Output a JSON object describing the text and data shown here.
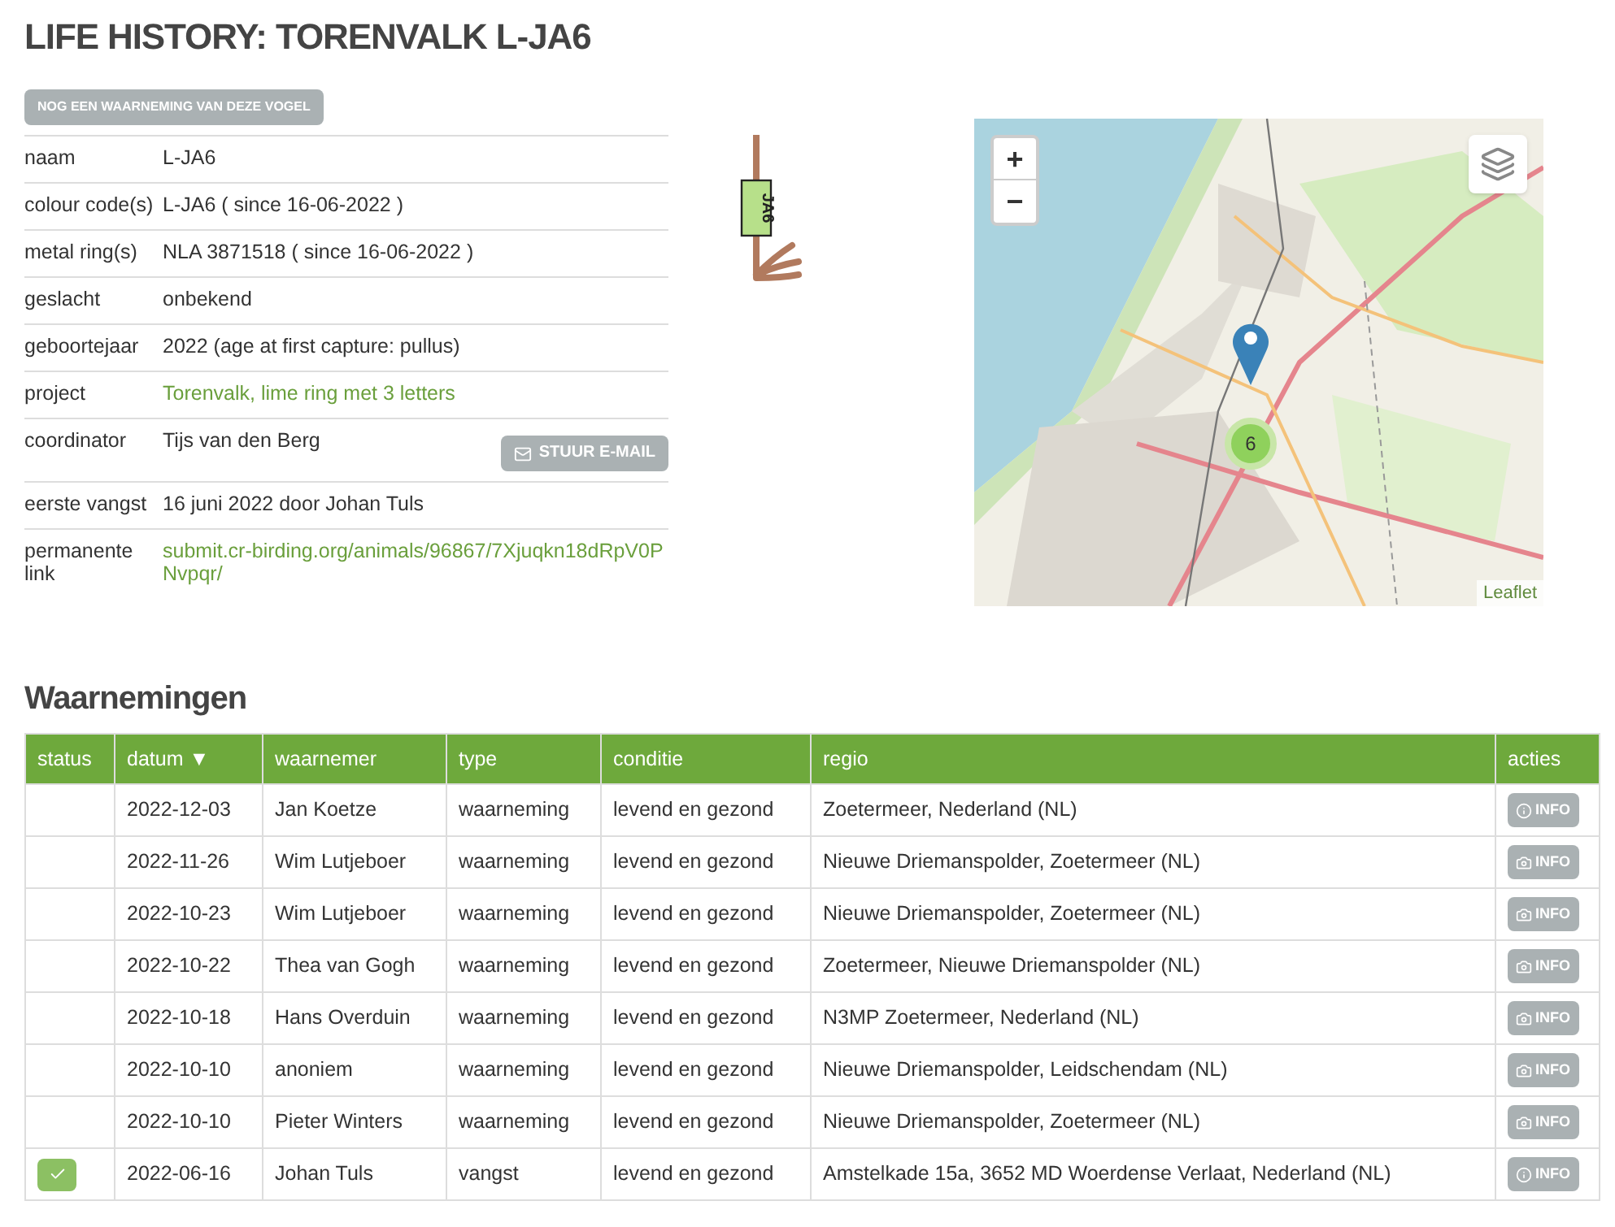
{
  "title": "LIFE HISTORY: TORENVALK L-JA6",
  "another_button": "NOG EEN WAARNEMING VAN DEZE VOGEL",
  "details": [
    {
      "label": "naam",
      "value": "L-JA6",
      "kind": "text"
    },
    {
      "label": "colour code(s)",
      "value": "L-JA6 ( since 16-06-2022 )",
      "kind": "text"
    },
    {
      "label": "metal ring(s)",
      "value": "NLA 3871518 ( since 16-06-2022 )",
      "kind": "text"
    },
    {
      "label": "geslacht",
      "value": "onbekend",
      "kind": "text"
    },
    {
      "label": "geboortejaar",
      "value": "2022 (age at first capture: pullus)",
      "kind": "text"
    },
    {
      "label": "project",
      "value": "Torenvalk, lime ring met 3 letters",
      "kind": "link"
    },
    {
      "label": "coordinator",
      "value": "Tijs van den Berg",
      "kind": "email",
      "button": "STUUR E-MAIL"
    },
    {
      "label": "eerste vangst",
      "value": "16 juni 2022 door Johan Tuls",
      "kind": "text"
    },
    {
      "label": "permanente link",
      "value": "submit.cr-birding.org/animals/96867/7Xjuqkn18dRpV0PNvpqr/",
      "kind": "link"
    }
  ],
  "ring": {
    "code": "JA6"
  },
  "map": {
    "zoom_in": "+",
    "zoom_out": "−",
    "cluster_count": "6",
    "attribution": "Leaflet"
  },
  "section_title": "Waarnemingen",
  "table": {
    "columns": [
      {
        "label": "status"
      },
      {
        "label": "datum ▼"
      },
      {
        "label": "waarnemer"
      },
      {
        "label": "type"
      },
      {
        "label": "conditie"
      },
      {
        "label": "regio"
      },
      {
        "label": "acties"
      }
    ],
    "rows": [
      {
        "verified": false,
        "datum": "2022-12-03",
        "waarnemer": "Jan Koetze",
        "type": "waarneming",
        "conditie": "levend en gezond",
        "regio": "Zoetermeer, Nederland (NL)",
        "action": "INFO",
        "kind": "info"
      },
      {
        "verified": false,
        "datum": "2022-11-26",
        "waarnemer": "Wim Lutjeboer",
        "type": "waarneming",
        "conditie": "levend en gezond",
        "regio": "Nieuwe Driemanspolder, Zoetermeer (NL)",
        "action": "INFO",
        "kind": "camera"
      },
      {
        "verified": false,
        "datum": "2022-10-23",
        "waarnemer": "Wim Lutjeboer",
        "type": "waarneming",
        "conditie": "levend en gezond",
        "regio": "Nieuwe Driemanspolder, Zoetermeer (NL)",
        "action": "INFO",
        "kind": "camera"
      },
      {
        "verified": false,
        "datum": "2022-10-22",
        "waarnemer": "Thea van Gogh",
        "type": "waarneming",
        "conditie": "levend en gezond",
        "regio": "Zoetermeer, Nieuwe Driemanspolder (NL)",
        "action": "INFO",
        "kind": "camera"
      },
      {
        "verified": false,
        "datum": "2022-10-18",
        "waarnemer": "Hans Overduin",
        "type": "waarneming",
        "conditie": "levend en gezond",
        "regio": "N3MP Zoetermeer, Nederland (NL)",
        "action": "INFO",
        "kind": "camera"
      },
      {
        "verified": false,
        "datum": "2022-10-10",
        "waarnemer": "anoniem",
        "type": "waarneming",
        "conditie": "levend en gezond",
        "regio": "Nieuwe Driemanspolder, Leidschendam (NL)",
        "action": "INFO",
        "kind": "camera"
      },
      {
        "verified": false,
        "datum": "2022-10-10",
        "waarnemer": "Pieter Winters",
        "type": "waarneming",
        "conditie": "levend en gezond",
        "regio": "Nieuwe Driemanspolder, Zoetermeer (NL)",
        "action": "INFO",
        "kind": "camera"
      },
      {
        "verified": true,
        "datum": "2022-06-16",
        "waarnemer": "Johan Tuls",
        "type": "vangst",
        "conditie": "levend en gezond",
        "regio": "Amstelkade 15a, 3652 MD Woerdense Verlaat, Nederland (NL)",
        "action": "INFO",
        "kind": "info"
      }
    ]
  }
}
